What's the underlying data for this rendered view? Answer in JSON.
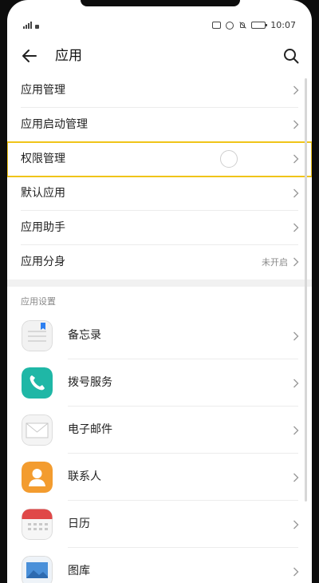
{
  "status_bar": {
    "time": "10:07"
  },
  "header": {
    "title": "应用"
  },
  "menu": [
    {
      "label": "应用管理",
      "value": ""
    },
    {
      "label": "应用启动管理",
      "value": ""
    },
    {
      "label": "权限管理",
      "value": "",
      "highlighted": true
    },
    {
      "label": "默认应用",
      "value": ""
    },
    {
      "label": "应用助手",
      "value": ""
    },
    {
      "label": "应用分身",
      "value": "未开启"
    }
  ],
  "section": {
    "label": "应用设置"
  },
  "apps": [
    {
      "name": "备忘录",
      "icon": "notes-icon"
    },
    {
      "name": "拨号服务",
      "icon": "phone-icon"
    },
    {
      "name": "电子邮件",
      "icon": "email-icon"
    },
    {
      "name": "联系人",
      "icon": "contacts-icon"
    },
    {
      "name": "日历",
      "icon": "calendar-icon"
    },
    {
      "name": "图库",
      "icon": "gallery-icon"
    }
  ],
  "colors": {
    "highlight": "#f0c419",
    "phone_icon": "#1fb7a6",
    "contacts_icon": "#f39c2f",
    "calendar_accent": "#e04848"
  }
}
